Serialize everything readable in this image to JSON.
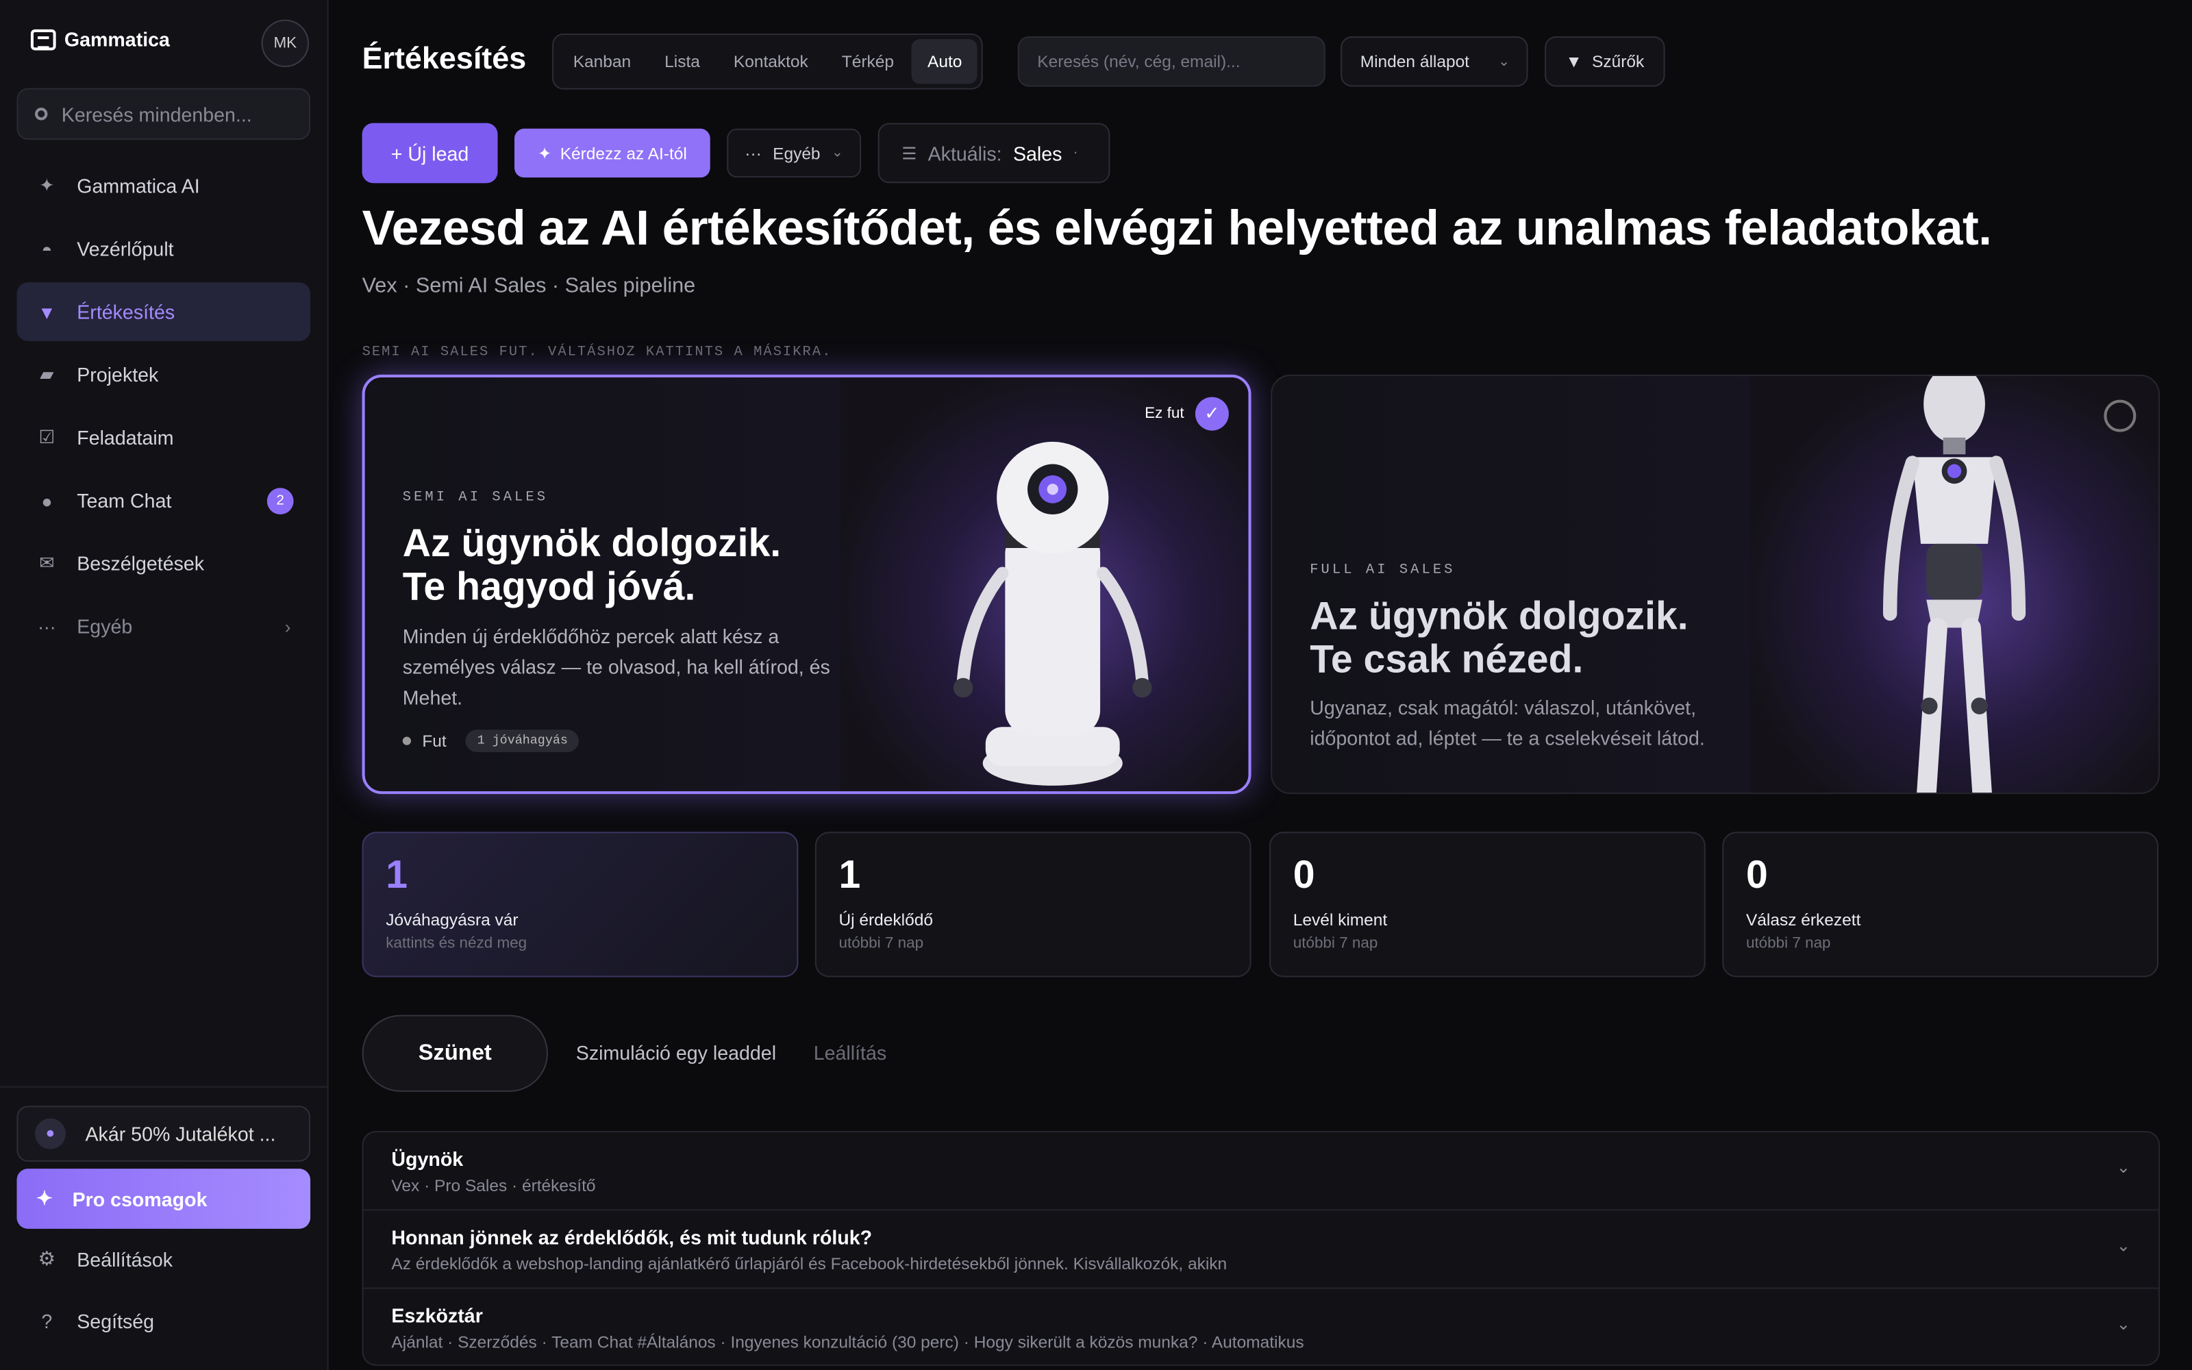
{
  "sidebar": {
    "brand": "Gammatica",
    "avatar": "MK",
    "search_placeholder": "Keresés mindenben...",
    "items": [
      {
        "label": "Gammatica AI",
        "icon": "sparkle-icon"
      },
      {
        "label": "Vezérlőpult",
        "icon": "dashboard-icon"
      },
      {
        "label": "Értékesítés",
        "icon": "funnel-icon",
        "active": true
      },
      {
        "label": "Projektek",
        "icon": "folder-icon"
      },
      {
        "label": "Feladataim",
        "icon": "checkbox-icon"
      },
      {
        "label": "Team Chat",
        "icon": "chat-icon",
        "badge": "2"
      },
      {
        "label": "Beszélgetések",
        "icon": "mail-icon"
      },
      {
        "label": "Egyéb",
        "icon": "more-icon"
      }
    ],
    "promo": "Akár 50% Jutalékot ...",
    "pro": "Pro csomagok",
    "settings": "Beállítások",
    "help": "Segítség"
  },
  "header": {
    "title": "Értékesítés",
    "tabs": [
      "Kanban",
      "Lista",
      "Kontaktok",
      "Térkép",
      "Auto"
    ],
    "active_tab": "Auto",
    "search_placeholder": "Keresés (név, cég, email)...",
    "status": "Minden állapot",
    "filters": "Szűrők"
  },
  "actions": {
    "new_lead": "+ Új lead",
    "ask_ai": "Kérdezz az AI-tól",
    "other": "Egyéb",
    "current_label": "Aktuális:",
    "current_value": "Sales"
  },
  "hero": {
    "headline": "Vezesd az AI értékesítődet, és elvégzi helyetted az unalmas feladatokat.",
    "subline": "Vex · Semi AI Sales · Sales pipeline",
    "note": "SEMI AI SALES FUT. VÁLTÁSHOZ KATTINTS A MÁSIKRA."
  },
  "cards": [
    {
      "eyebrow": "SEMI AI SALES",
      "title1": "Az ügynök dolgozik.",
      "title2": "Te hagyod jóvá.",
      "desc": "Minden új érdeklődőhöz percek alatt kész a személyes válasz — te olvasod, ha kell átírod, és Mehet.",
      "running": "Ez fut",
      "state": "Fut",
      "tag": "1 jóváhagyás",
      "selected": true
    },
    {
      "eyebrow": "FULL AI SALES",
      "title1": "Az ügynök dolgozik.",
      "title2": "Te csak nézed.",
      "desc": "Ugyanaz, csak magától: válaszol, utánkövet, időpontot ad, léptet — te a cselekvéseit látod.",
      "selected": false
    }
  ],
  "stats": [
    {
      "value": "1",
      "label": "Jóváhagyásra vár",
      "sub": "kattints és nézd meg"
    },
    {
      "value": "1",
      "label": "Új érdeklődő",
      "sub": "utóbbi 7 nap"
    },
    {
      "value": "0",
      "label": "Levél kiment",
      "sub": "utóbbi 7 nap"
    },
    {
      "value": "0",
      "label": "Válasz érkezett",
      "sub": "utóbbi 7 nap"
    }
  ],
  "controls": {
    "pause": "Szünet",
    "simulate": "Szimuláció egy leaddel",
    "stop": "Leállítás"
  },
  "accordion": [
    {
      "title": "Ügynök",
      "sub": "Vex · Pro Sales · értékesítő"
    },
    {
      "title": "Honnan jönnek az érdeklődők, és mit tudunk róluk?",
      "sub": "Az érdeklődők a webshop-landing ajánlatkérő űrlapjáról és Facebook-hirdetésekből jönnek. Kisvállalkozók, akikn"
    },
    {
      "title": "Eszköztár",
      "sub": "Ajánlat · Szerződés · Team Chat #Általános · Ingyenes konzultáció (30 perc) · Hogy sikerült a közös munka? · Automatikus"
    }
  ],
  "colors": {
    "accent": "#8b6cf6",
    "background": "#0b0b0e",
    "sidebar": "#111116"
  }
}
